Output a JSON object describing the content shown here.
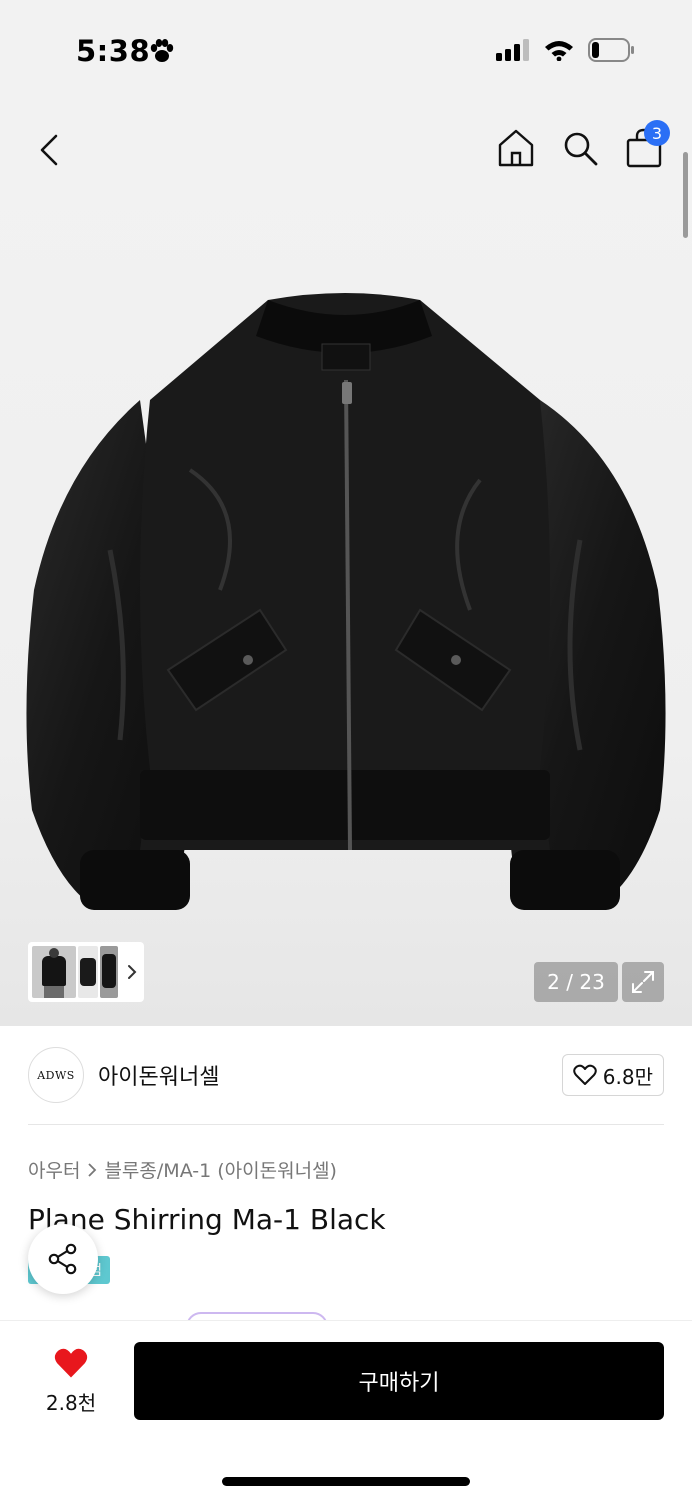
{
  "status_bar": {
    "time": "5:38",
    "battery_level": 0.2
  },
  "top_nav": {
    "cart_count": "3"
  },
  "gallery": {
    "counter": "2 / 23"
  },
  "brand": {
    "logo_text": "ADWS",
    "name": "아이돈워너셀",
    "likes": "6.8만"
  },
  "breadcrumb": {
    "category": "아우터",
    "subcategory": "블루종/MA-1 (아이돈워너셀)"
  },
  "product": {
    "title": "Plane Shirring Ma-1 Black",
    "tag_label": "럼"
  },
  "bottom_bar": {
    "wish_count": "2.8천",
    "buy_label": "구매하기"
  },
  "colors": {
    "accent_blue": "#2b6ff5",
    "heart_red": "#e8171d",
    "tag_teal": "#5ec8d0",
    "buy_black": "#000000"
  }
}
